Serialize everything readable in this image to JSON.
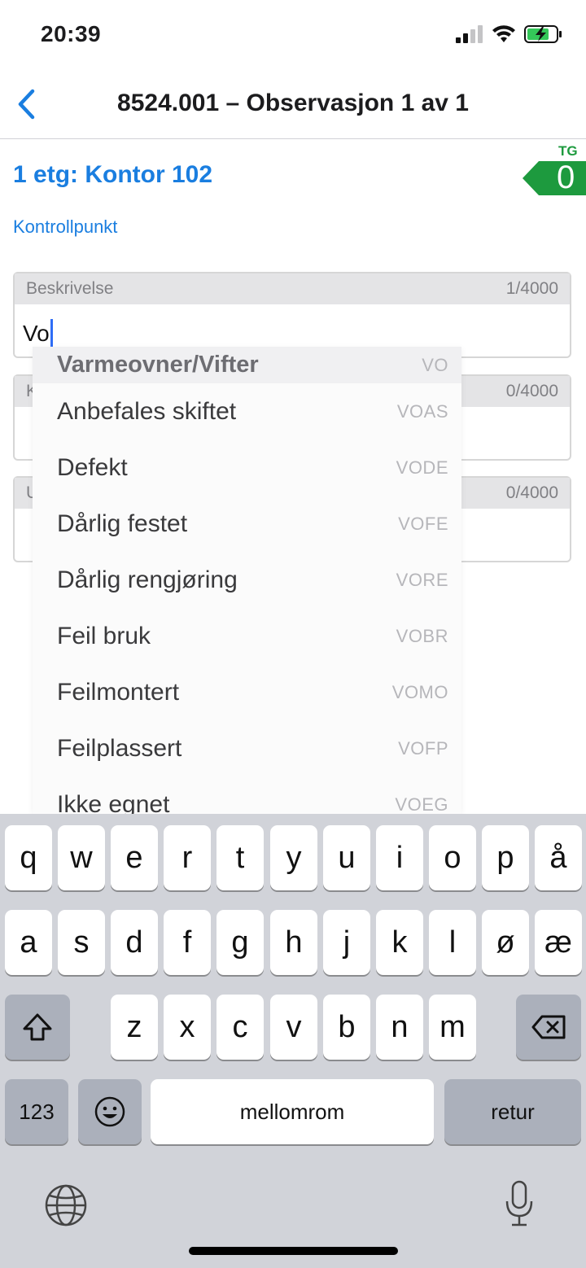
{
  "status": {
    "time": "20:39"
  },
  "nav": {
    "title": "8524.001 – Observasjon 1 av 1"
  },
  "header": {
    "room": "1 etg: Kontor 102",
    "tg_label": "TG",
    "tg_value": "0",
    "section_link": "Kontrollpunkt"
  },
  "fields": [
    {
      "label": "Beskrivelse",
      "count": "1/4000",
      "value": "Vo"
    },
    {
      "label": "K",
      "count": "0/4000"
    },
    {
      "label": "U",
      "count": "0/4000"
    }
  ],
  "suggestions": {
    "category": {
      "label": "Varmeovner/Vifter",
      "code": "VO"
    },
    "items": [
      {
        "label": "Anbefales skiftet",
        "code": "VOAS"
      },
      {
        "label": "Defekt",
        "code": "VODE"
      },
      {
        "label": "Dårlig festet",
        "code": "VOFE"
      },
      {
        "label": "Dårlig rengjøring",
        "code": "VORE"
      },
      {
        "label": "Feil bruk",
        "code": "VOBR"
      },
      {
        "label": "Feilmontert",
        "code": "VOMO"
      },
      {
        "label": "Feilplassert",
        "code": "VOFP"
      },
      {
        "label": "Ikke egnet",
        "code": "VOEG"
      }
    ]
  },
  "keyboard": {
    "row1": [
      "q",
      "w",
      "e",
      "r",
      "t",
      "y",
      "u",
      "i",
      "o",
      "p",
      "å"
    ],
    "row2": [
      "a",
      "s",
      "d",
      "f",
      "g",
      "h",
      "j",
      "k",
      "l",
      "ø",
      "æ"
    ],
    "row3": [
      "z",
      "x",
      "c",
      "v",
      "b",
      "n",
      "m"
    ],
    "numbers_label": "123",
    "space_label": "mellomrom",
    "return_label": "retur"
  },
  "colors": {
    "accent": "#1a7ee0",
    "tg_green": "#1d9a3e",
    "keyboard_bg": "#d1d3d9"
  }
}
